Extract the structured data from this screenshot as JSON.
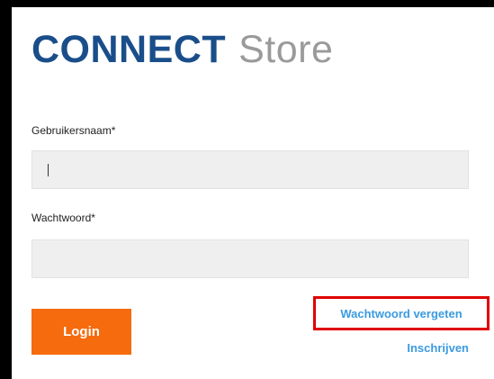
{
  "brand": {
    "name_bold": "CONNECT",
    "name_light": "Store",
    "colors": {
      "primary": "#1a4e8a",
      "secondary": "#9a9a9a"
    }
  },
  "form": {
    "username": {
      "label": "Gebruikersnaam*",
      "value": "",
      "placeholder": ""
    },
    "password": {
      "label": "Wachtwoord*",
      "value": "",
      "placeholder": ""
    },
    "login_label": "Login",
    "forgot_password_label": "Wachtwoord vergeten",
    "register_label": "Inschrijven"
  },
  "colors": {
    "login_button": "#f56b0e",
    "link": "#3a9be0",
    "highlight_box": "#e00000",
    "input_background": "#efefef"
  }
}
